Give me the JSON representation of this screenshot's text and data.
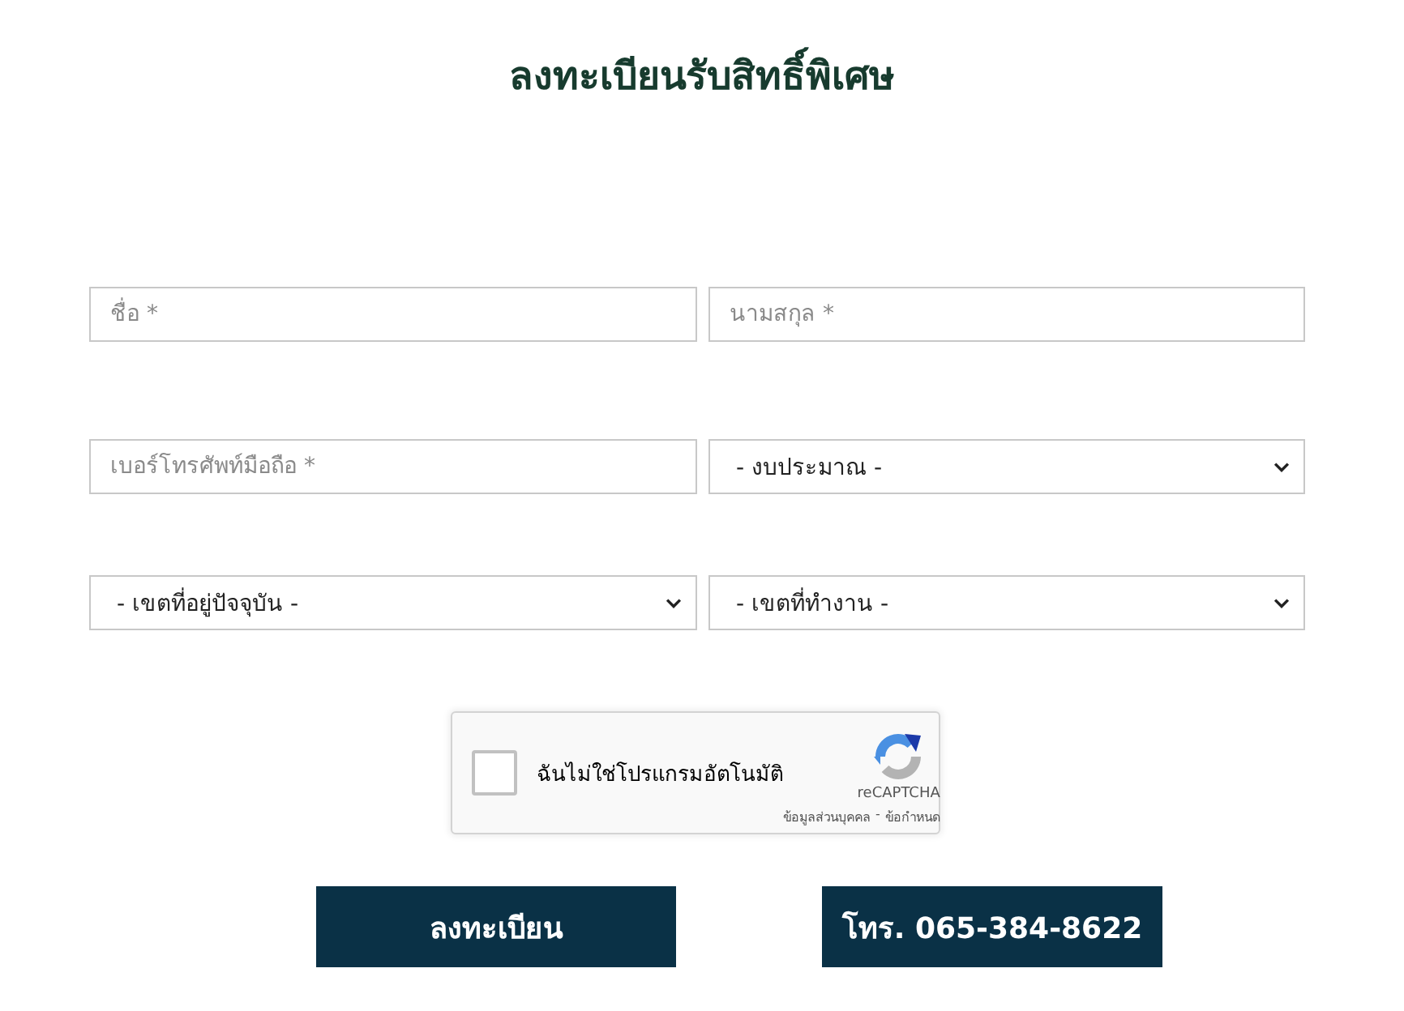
{
  "title": "ลงทะเบียนรับสิทธิ์พิเศษ",
  "rows": [
    [
      {
        "kind": "text",
        "placeholder": "ชื่อ *"
      },
      {
        "kind": "text",
        "placeholder": "นามสกุล *"
      }
    ],
    [
      {
        "kind": "text",
        "placeholder": "เบอร์โทรศัพท์มือถือ *"
      },
      {
        "kind": "select",
        "value": "- งบประมาณ -"
      }
    ],
    [
      {
        "kind": "select",
        "value": "- เขตที่อยู่ปัจจุบัน -"
      },
      {
        "kind": "select",
        "value": "- เขตที่ทำงาน -"
      }
    ]
  ],
  "captcha": {
    "label": "ฉันไม่ใช่โปรแกรมอัตโนมัติ",
    "checked": false,
    "brand": "reCAPTCHA",
    "privacy": "ข้อมูลส่วนบุคคล",
    "separator": "-",
    "terms": "ข้อกำหนด"
  },
  "buttons": [
    {
      "label": "ลงทะเบียน"
    },
    {
      "label": "โทร. 065-384-8622"
    }
  ]
}
